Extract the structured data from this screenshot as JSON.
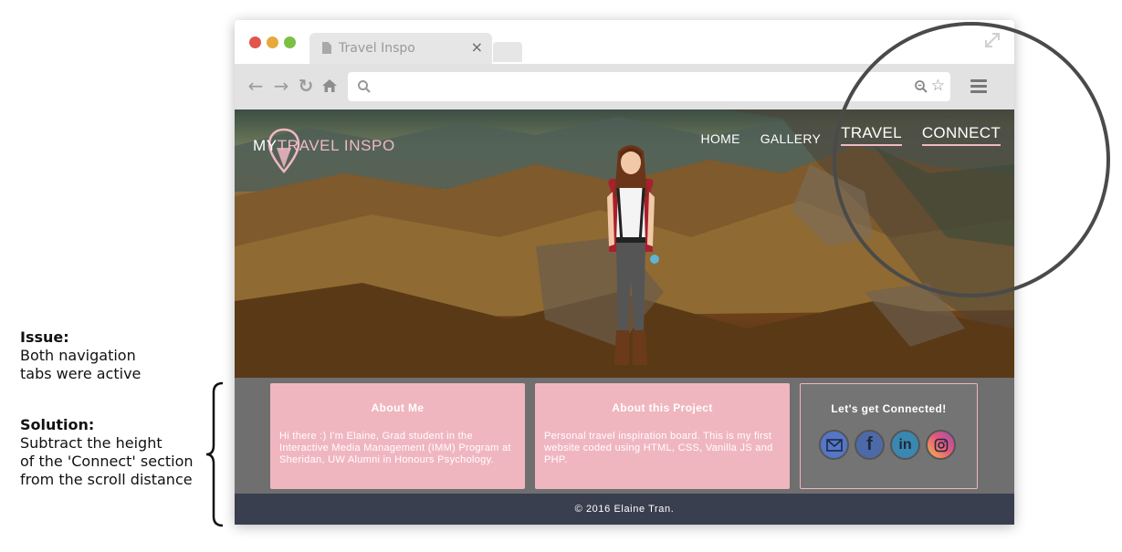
{
  "annotations": {
    "issue_title": "Issue:",
    "issue_lines": [
      "Both navigation",
      "tabs were active"
    ],
    "solution_title": "Solution:",
    "solution_lines": [
      "Subtract the height",
      "of the 'Connect' section",
      "from the scroll distance"
    ]
  },
  "browser": {
    "tab_title": "Travel Inspo",
    "tab_close": "×",
    "url_value": "",
    "nav_icons": [
      "back-arrow-icon",
      "forward-arrow-icon",
      "reload-icon",
      "home-icon"
    ]
  },
  "site": {
    "brand_prefix": "MY",
    "brand_accent": "TRAVEL INSPO",
    "nav": [
      {
        "label": "HOME",
        "active": false
      },
      {
        "label": "GALLERY",
        "active": false
      },
      {
        "label": "TRAVEL",
        "active": true
      },
      {
        "label": "CONNECT",
        "active": true
      }
    ],
    "cards": {
      "about_me": {
        "title": "About Me",
        "body": "Hi there :) I'm Elaine, Grad student in the Interactive Media Management (IMM) Program at Sheridan, UW Alumni in Honours Psychology."
      },
      "project": {
        "title": "About this Project",
        "body": "Personal travel inspiration board. This is my first website coded using HTML, CSS, Vanilla JS and PHP."
      },
      "connect": {
        "title": "Let's get Connected!",
        "social": [
          "mail-icon",
          "facebook-icon",
          "linkedin-icon",
          "instagram-icon"
        ]
      }
    },
    "footer": "© 2016 Elaine Tran."
  },
  "colors": {
    "accent_pink": "#f0b6c0",
    "footer_bg": "#3a3f4f",
    "cards_bg": "#6f6f6f"
  }
}
